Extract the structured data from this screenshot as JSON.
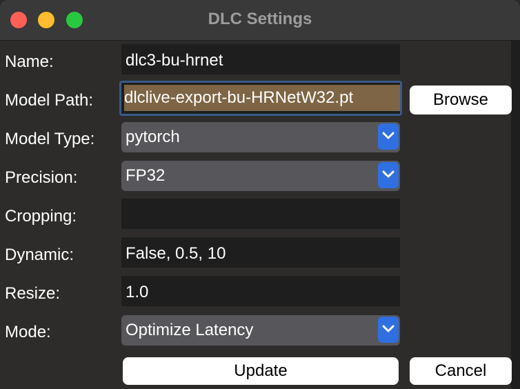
{
  "window": {
    "title": "DLC Settings"
  },
  "form": {
    "name_label": "Name:",
    "name_value": "dlc3-bu-hrnet",
    "model_path_label": "Model Path:",
    "model_path_value": "dlclive-export-bu-HRNetW32.pt",
    "browse_label": "Browse",
    "model_type_label": "Model Type:",
    "model_type_value": "pytorch",
    "precision_label": "Precision:",
    "precision_value": "FP32",
    "cropping_label": "Cropping:",
    "cropping_value": "",
    "dynamic_label": "Dynamic:",
    "dynamic_value": "False, 0.5, 10",
    "resize_label": "Resize:",
    "resize_value": "1.0",
    "mode_label": "Mode:",
    "mode_value": "Optimize Latency"
  },
  "buttons": {
    "update": "Update",
    "cancel": "Cancel"
  },
  "colors": {
    "accent": "#2f6fe0",
    "selection": "#7d6545",
    "focus_ring": "#3a5a88",
    "traffic_red": "#fe5f57",
    "traffic_yellow": "#febc2e",
    "traffic_green": "#28c840"
  }
}
